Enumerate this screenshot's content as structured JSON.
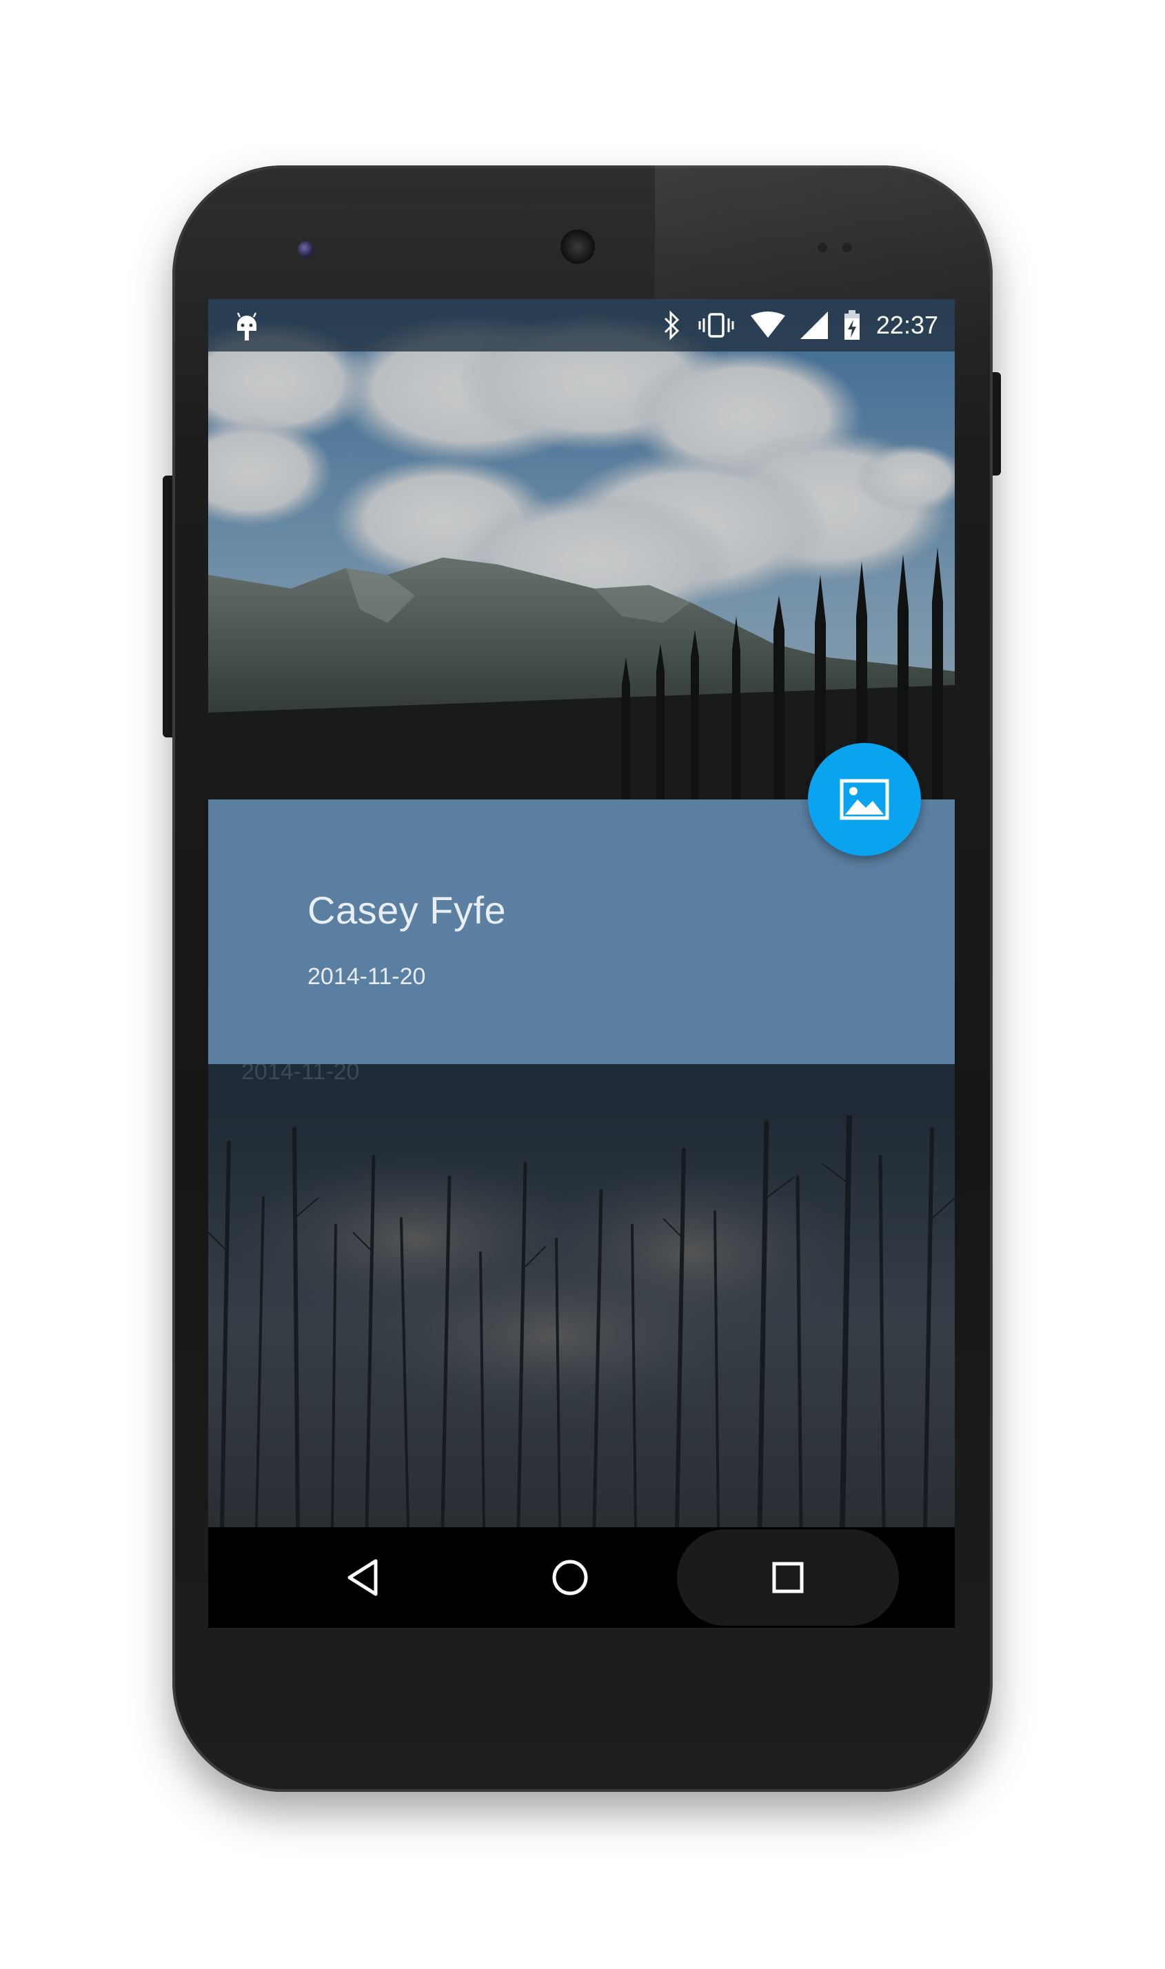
{
  "status_bar": {
    "time": "22:37",
    "icons": [
      "android-debug-icon",
      "bluetooth-icon",
      "vibrate-icon",
      "wifi-icon",
      "cell-signal-icon",
      "battery-charging-icon"
    ]
  },
  "card": {
    "title": "Casey Fyfe",
    "date": "2014-11-20"
  },
  "background_item": {
    "date": "2014-11-20"
  },
  "fab": {
    "icon": "image-icon",
    "color": "#0aa3ef"
  },
  "nav_bar": {
    "buttons": [
      "back-icon",
      "home-icon",
      "recents-icon"
    ]
  },
  "colors": {
    "card": "#5a7fa1",
    "fab": "#0aa3ef",
    "status_bar": "#233241"
  }
}
